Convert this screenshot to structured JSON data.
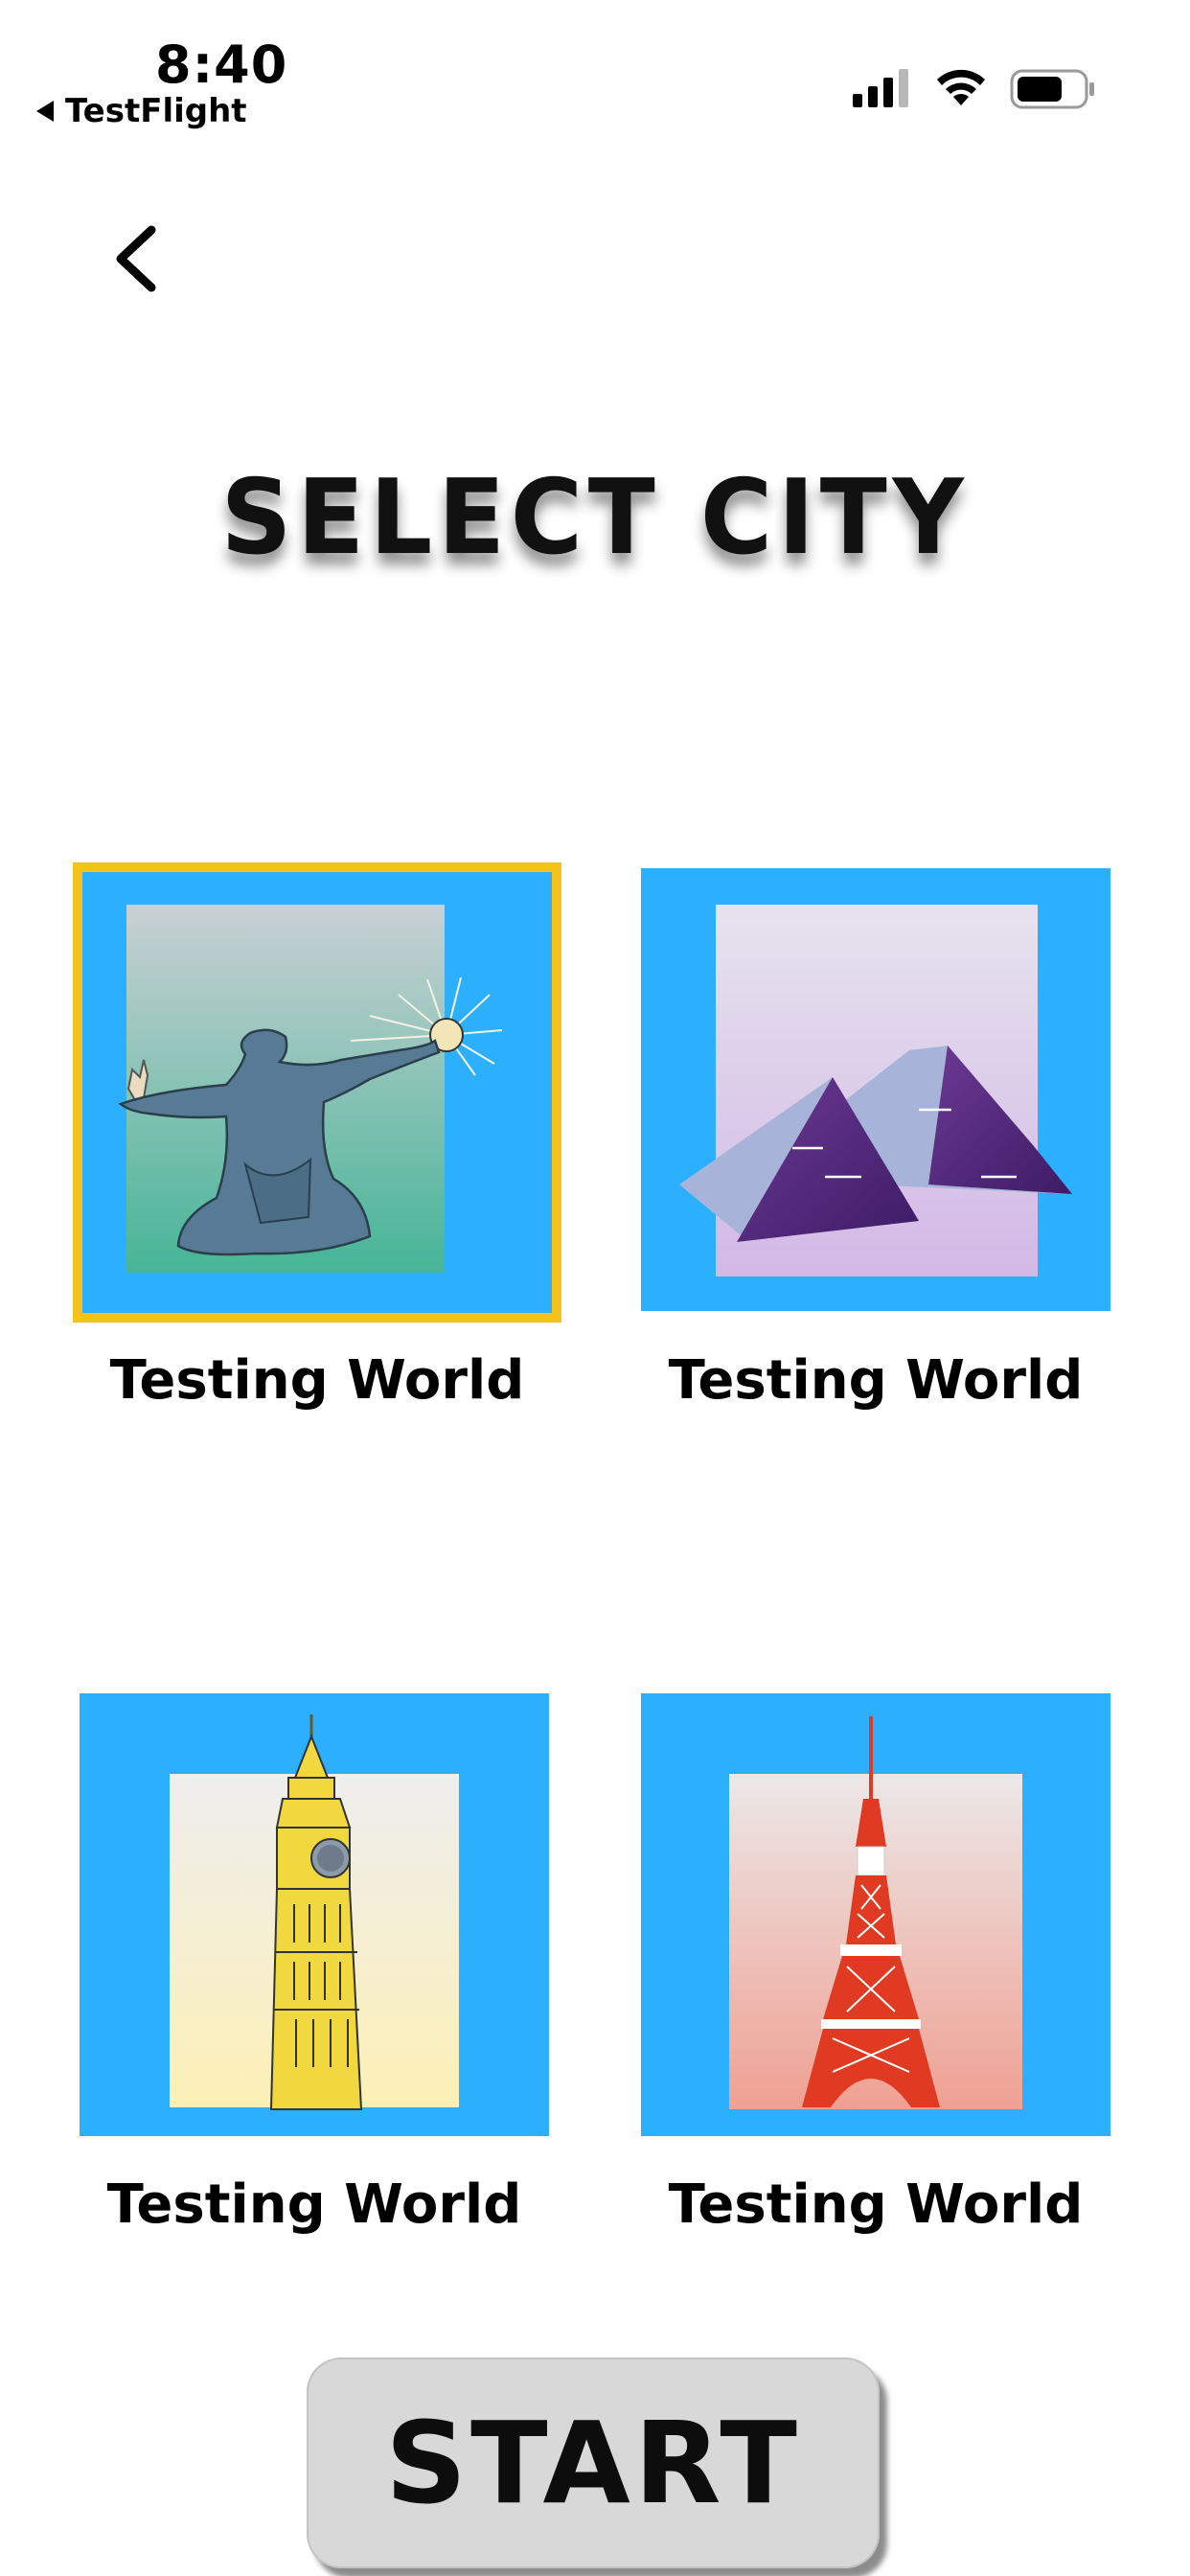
{
  "status_bar": {
    "time": "8:40",
    "back_app_label": "TestFlight",
    "icons": [
      "signal-icon",
      "wifi-icon",
      "battery-icon"
    ]
  },
  "header": {
    "back_icon": "chevron-left-icon",
    "title": "SELECT CITY"
  },
  "cities": [
    {
      "label": "Testing World",
      "illustration": "detroit-spirit-statue",
      "selected": true
    },
    {
      "label": "Testing World",
      "illustration": "giza-pyramids",
      "selected": false
    },
    {
      "label": "Testing World",
      "illustration": "big-ben-tower",
      "selected": false
    },
    {
      "label": "Testing World",
      "illustration": "tokyo-tower",
      "selected": false
    }
  ],
  "start_button": {
    "label": "START"
  },
  "colors": {
    "card_background": "#2cb0fe",
    "selected_border": "#f5c21a",
    "start_button": "#d8d8d8"
  }
}
